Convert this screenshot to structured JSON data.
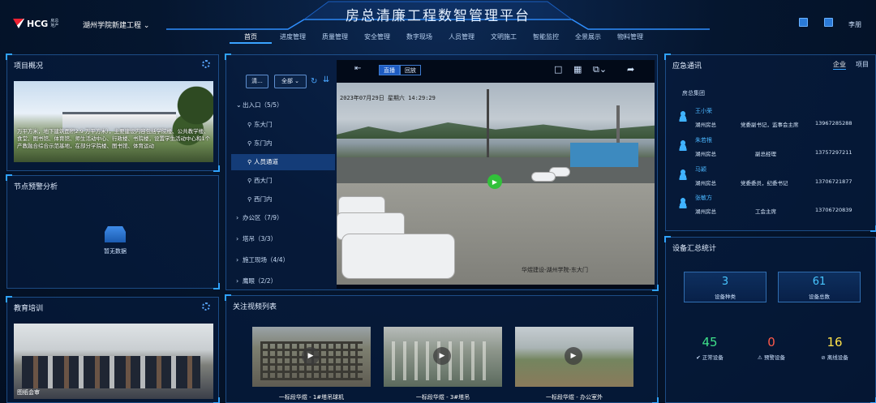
{
  "header": {
    "logo_text": "HCG",
    "logo_sub": "房总地产",
    "project": "湖州学院新建工程",
    "title": "房总清廉工程数智管理平台",
    "user": "李朋",
    "nav": [
      "首页",
      "进度管理",
      "质量管理",
      "安全管理",
      "数字现场",
      "人员管理",
      "文明施工",
      "智能监控",
      "全景展示",
      "物料管理"
    ],
    "active_nav": "首页"
  },
  "overview": {
    "title": "项目概况",
    "text": "万平方米，地下建筑面积2.9 万平方米），主要建设内容包括学院楼、公共教学楼、食堂、图书馆、体育馆、师生活动中心、行政楼、书院楼，设置学生活动中心和1个产教融合综合示范基地，在部分学院楼、图书馆、体育运动"
  },
  "node": {
    "title": "节点预警分析",
    "empty": "暂无数据"
  },
  "edu": {
    "title": "教育培训",
    "caption": "图纸会审"
  },
  "video": {
    "btn_clear": "清...",
    "btn_all": "全部",
    "tree": [
      {
        "label": "出入口（5/5）",
        "type": "grp",
        "open": true
      },
      {
        "label": "东大门",
        "type": "leaf"
      },
      {
        "label": "东门内",
        "type": "leaf"
      },
      {
        "label": "人员通道",
        "type": "leaf",
        "active": true
      },
      {
        "label": "西大门",
        "type": "leaf"
      },
      {
        "label": "西门内",
        "type": "leaf"
      },
      {
        "label": "办公区（7/9）",
        "type": "grp"
      },
      {
        "label": "塔吊（3/3）",
        "type": "grp"
      },
      {
        "label": "施工现场（4/4）",
        "type": "grp"
      },
      {
        "label": "鹰眼（2/2）",
        "type": "grp"
      }
    ],
    "tab_live": "直播",
    "tab_back": "回放",
    "timestamp": "2023年07月29日  星期六  14:29:29",
    "cam_label": "华煜建设-湖州学院-东大门"
  },
  "watch": {
    "title": "关注视频列表",
    "items": [
      {
        "caption": "一标段华煜 - 1#塔吊球机"
      },
      {
        "caption": "一标段华煜 - 3#塔吊"
      },
      {
        "caption": "一标段华煜 - 办公室外"
      }
    ]
  },
  "emergency": {
    "title": "应急通讯",
    "tabs": [
      "企业",
      "项目"
    ],
    "active_tab": "企业",
    "group": "房总集团",
    "contacts": [
      {
        "name": "王小荣",
        "org": "湖州房总",
        "role": "党委副书记，监事会主席",
        "tel": "13967285288"
      },
      {
        "name": "朱若根",
        "org": "湖州房总",
        "role": "副总经理",
        "tel": "13757297211"
      },
      {
        "name": "马颖",
        "org": "湖州房总",
        "role": "党委委员，纪委书记",
        "tel": "13706721877"
      },
      {
        "name": "张敏方",
        "org": "湖州房总",
        "role": "工会主席",
        "tel": "13706720839"
      }
    ]
  },
  "devices": {
    "title": "设备汇总统计",
    "kinds": {
      "value": "3",
      "label": "设备种类"
    },
    "total": {
      "value": "61",
      "label": "设备总数"
    },
    "normal": {
      "value": "45",
      "label": "正常设备",
      "color": "#3ee08a"
    },
    "warning": {
      "value": "0",
      "label": "预警设备",
      "color": "#ff5a4a"
    },
    "offline": {
      "value": "16",
      "label": "离线设备",
      "color": "#ffe24a"
    }
  }
}
